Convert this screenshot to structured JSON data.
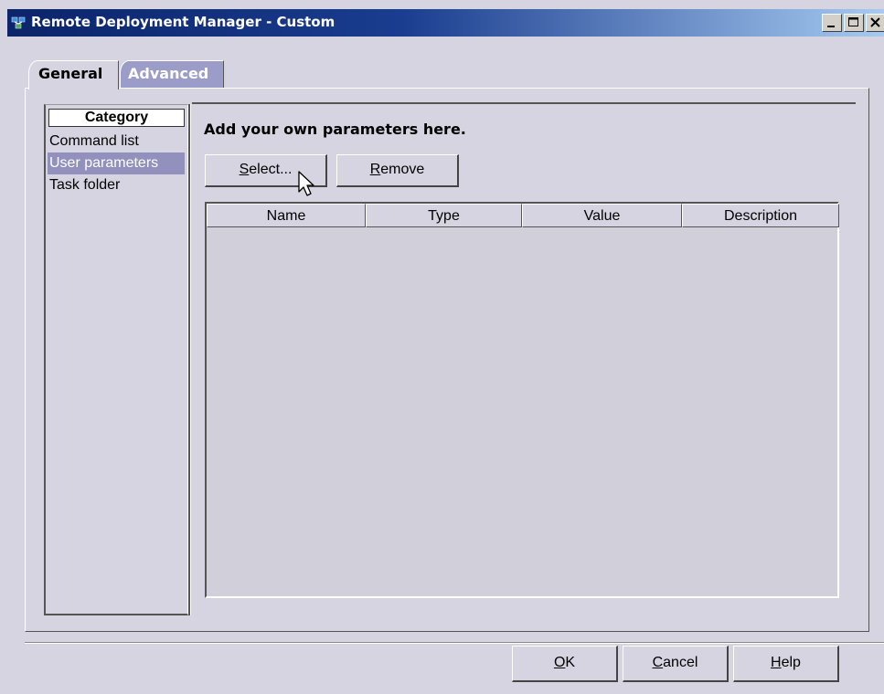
{
  "window": {
    "title": "Remote Deployment Manager - Custom",
    "title_icon": "app-network-icon",
    "controls": [
      "minimize-icon",
      "maximize-icon",
      "close-icon"
    ]
  },
  "tabs": [
    {
      "label": "General",
      "active": true
    },
    {
      "label": "Advanced",
      "active": false
    }
  ],
  "category": {
    "header": "Category",
    "items": [
      {
        "label": "Command list",
        "selected": false
      },
      {
        "label": "User parameters",
        "selected": true
      },
      {
        "label": "Task folder",
        "selected": false
      }
    ]
  },
  "panel": {
    "heading": "Add your own parameters here.",
    "select_button": {
      "mnemonic": "S",
      "rest": "elect..."
    },
    "remove_button": {
      "mnemonic": "R",
      "rest": "emove"
    },
    "table": {
      "columns": [
        "Name",
        "Type",
        "Value",
        "Description"
      ],
      "rows": []
    }
  },
  "footer": {
    "ok": {
      "mnemonic": "O",
      "rest": "K"
    },
    "cancel": {
      "mnemonic": "C",
      "rest": "ancel"
    },
    "help": {
      "mnemonic": "H",
      "rest": "elp"
    }
  },
  "colors": {
    "titlebar_start": "#0b246a",
    "titlebar_end": "#a6caf0",
    "selection": "#9290bd",
    "background": "#d6d4e1"
  }
}
